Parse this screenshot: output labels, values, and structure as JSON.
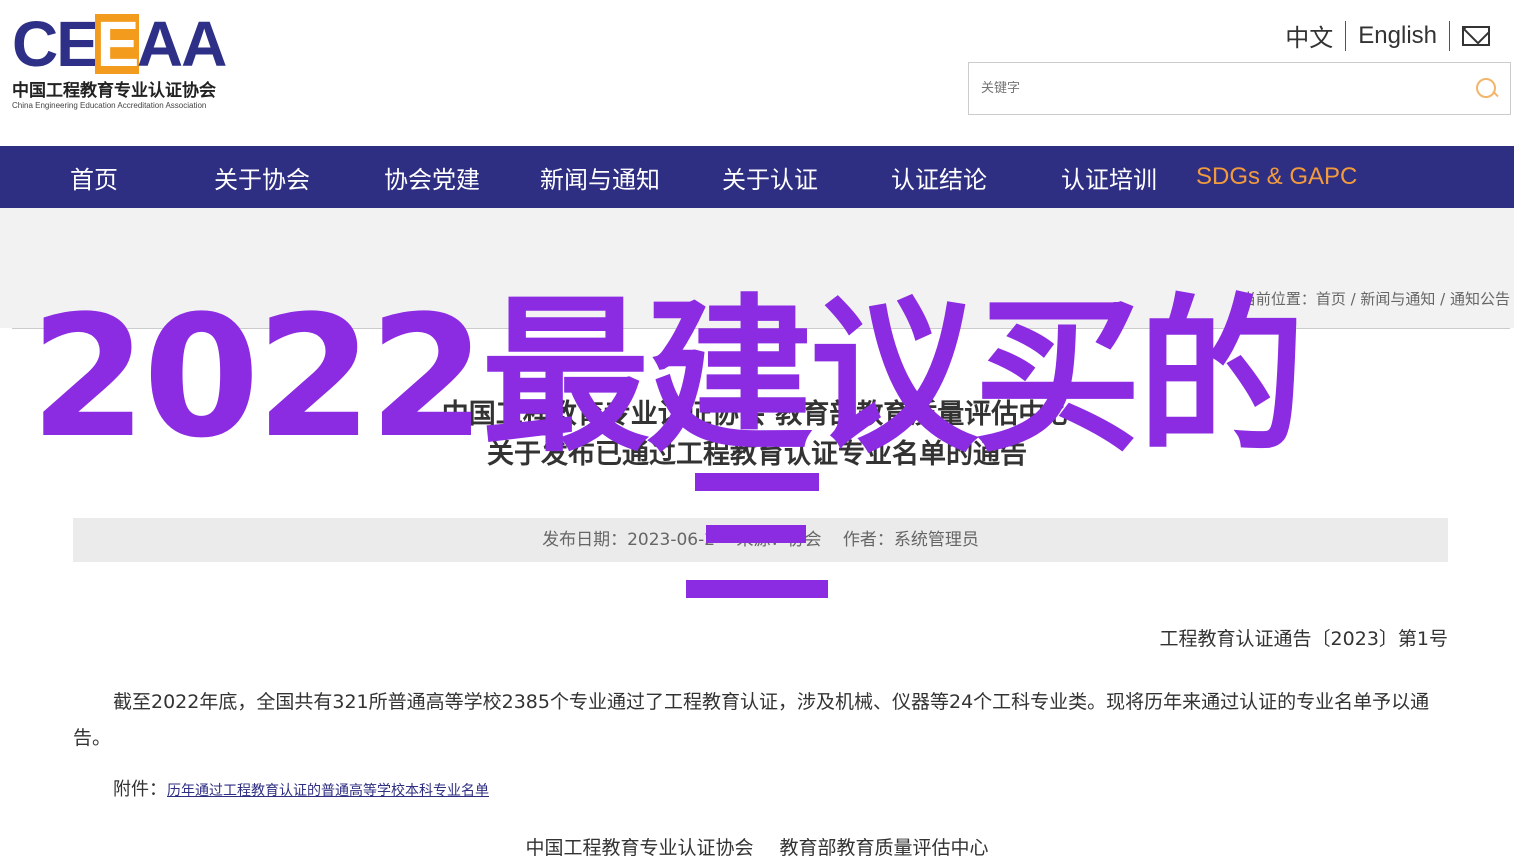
{
  "header": {
    "logo": {
      "mark": "CEEAA",
      "name_cn": "中国工程教育专业认证协会",
      "name_en": "China Engineering Education Accreditation Association"
    },
    "lang": [
      "中文",
      "English"
    ],
    "search_placeholder": "关键字"
  },
  "nav": {
    "items": [
      "首页",
      "关于协会",
      "协会党建",
      "新闻与通知",
      "关于认证",
      "认证结论",
      "认证培训",
      "SDGs & GAPC"
    ],
    "highlight_color": "#f29b3c",
    "bg_color": "#2e2e82"
  },
  "breadcrumb": "当前位置：首页 / 新闻与通知 / 通知公告",
  "article": {
    "title_line1": "中国工程教育专业认证协会 教育部教育质量评估中心",
    "title_line2": "关于发布已通过工程教育认证专业名单的通告",
    "date": "发布日期：2023-06-2",
    "source": "来源：协会",
    "author": "作者：系统管理员",
    "doc_number": "工程教育认证通告〔2023〕第1号",
    "body": "截至2022年底，全国共有321所普通高等学校2385个专业通过了工程教育认证，涉及机械、仪器等24个工科专业类。现将历年来通过认证的专业名单予以通告。",
    "attachment_label": "附件：",
    "attachment_link": "历年通过工程教育认证的普通高等学校本科专业名单",
    "signature": [
      "中国工程教育专业认证协会",
      "教育部教育质量评估中心"
    ]
  },
  "overlay": {
    "text": "2022最建议买的",
    "color": "#8b2be2"
  }
}
